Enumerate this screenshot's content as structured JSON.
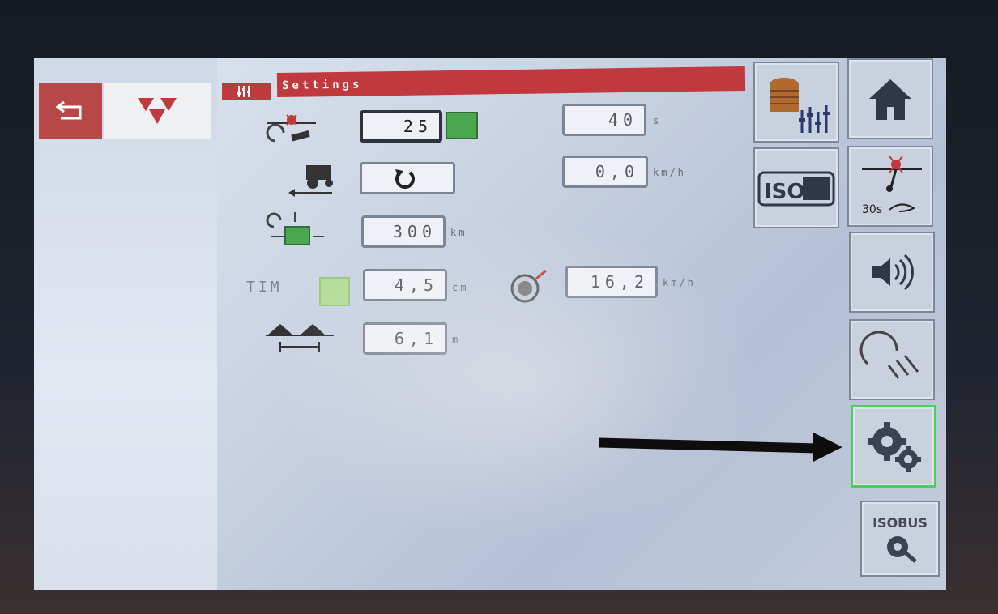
{
  "header": {
    "title": "Settings"
  },
  "settings": {
    "row1_value": "25",
    "row1_value_b": "40",
    "row1_unit_b": "s",
    "row2_value_b": "0,0",
    "row2_unit_b": "km/h",
    "row3_value": "300",
    "row3_unit": "km",
    "tim_label": "TIM",
    "row4_value": "4,5",
    "row4_unit": "cm",
    "row4_value_b": "16,2",
    "row4_unit_b": "km/h",
    "row5_value": "6,1",
    "row5_unit": "m"
  },
  "sidebar": {
    "timer_label": "30s",
    "isobus_logo": "ISOBUS",
    "isobus_settings_label": "ISOBUS"
  },
  "colors": {
    "accent_red": "#c0393e",
    "active_green": "#4ccf5a",
    "section_green": "#4aa64f"
  }
}
